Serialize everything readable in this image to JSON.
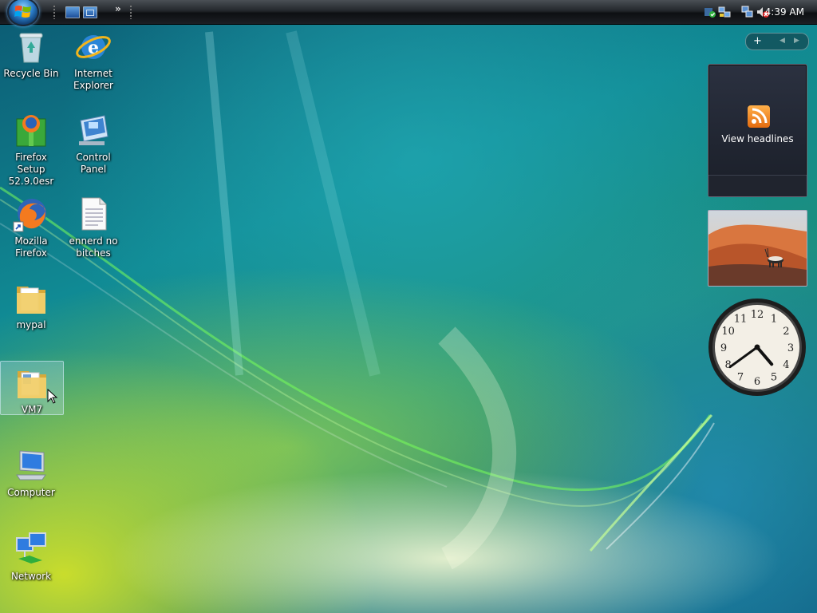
{
  "taskbar": {
    "clock": "4:39 AM",
    "quick_launch": [
      "show-desktop-icon",
      "switch-windows-icon"
    ],
    "tray_icons": [
      "windows-defender-icon",
      "network-connections-icon",
      "network-icon",
      "volume-muted-icon"
    ]
  },
  "desktop_icons": [
    {
      "id": "recycle-bin",
      "label": "Recycle Bin",
      "icon": "recycle-bin-icon"
    },
    {
      "id": "internet-explorer",
      "label": "Internet Explorer",
      "icon": "internet-explorer-icon"
    },
    {
      "id": "firefox-setup",
      "label": "Firefox Setup 52.9.0esr",
      "icon": "firefox-installer-icon"
    },
    {
      "id": "control-panel",
      "label": "Control Panel",
      "icon": "control-panel-icon"
    },
    {
      "id": "mozilla-firefox",
      "label": "Mozilla Firefox",
      "icon": "firefox-icon"
    },
    {
      "id": "ennerd-file",
      "label": "ennerd no bitches",
      "icon": "text-file-icon"
    },
    {
      "id": "mypal",
      "label": "mypal",
      "icon": "folder-icon"
    },
    {
      "id": "vm7",
      "label": "VM7",
      "icon": "folder-icon",
      "selected": true
    },
    {
      "id": "computer",
      "label": "Computer",
      "icon": "computer-icon"
    },
    {
      "id": "network",
      "label": "Network",
      "icon": "network-icon"
    }
  ],
  "sidebar": {
    "controls": [
      "+",
      "◀",
      "▶"
    ],
    "feed_gadget": {
      "label": "View headlines",
      "icon": "rss-icon"
    },
    "slideshow_gadget": {
      "icon": "oryx-desert-photo"
    },
    "clock_gadget": {
      "hour": 4,
      "minute": 39,
      "numbers": [
        "12",
        "1",
        "2",
        "3",
        "4",
        "5",
        "6",
        "7",
        "8",
        "9",
        "10",
        "11"
      ]
    }
  },
  "colors": {
    "taskbar": "#1c1f24",
    "selection": "#c8e6ff",
    "rss": "#f08a24"
  }
}
